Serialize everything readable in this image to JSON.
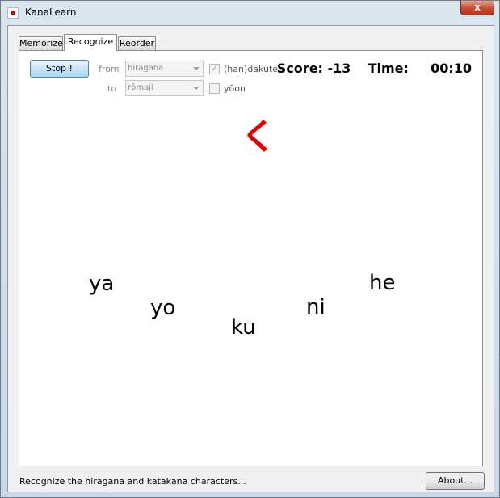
{
  "window": {
    "title": "KanaLearn",
    "close_glyph": "x"
  },
  "tabs": [
    {
      "label": "Memorize"
    },
    {
      "label": "Recognize"
    },
    {
      "label": "Reorder"
    }
  ],
  "controls": {
    "stop_label": "Stop !",
    "from_label": "from",
    "from_value": "hiragana",
    "to_label": "to",
    "to_value": "rōmaji",
    "dakuten_label": "(han)dakuten",
    "dakuten_checked": true,
    "yoon_label": "yōon",
    "yoon_checked": false
  },
  "score": {
    "score_label": "Score:",
    "score_value": "-13",
    "time_label": "Time:",
    "time_value": "00:10"
  },
  "game": {
    "kana": "く",
    "choices": [
      "ya",
      "yo",
      "ku",
      "ni",
      "he"
    ]
  },
  "footer": {
    "status": "Recognize the hiragana and katakana characters...",
    "about_label": "About..."
  },
  "colors": {
    "kana": "#e00000",
    "close_button": "#c74a2e"
  }
}
